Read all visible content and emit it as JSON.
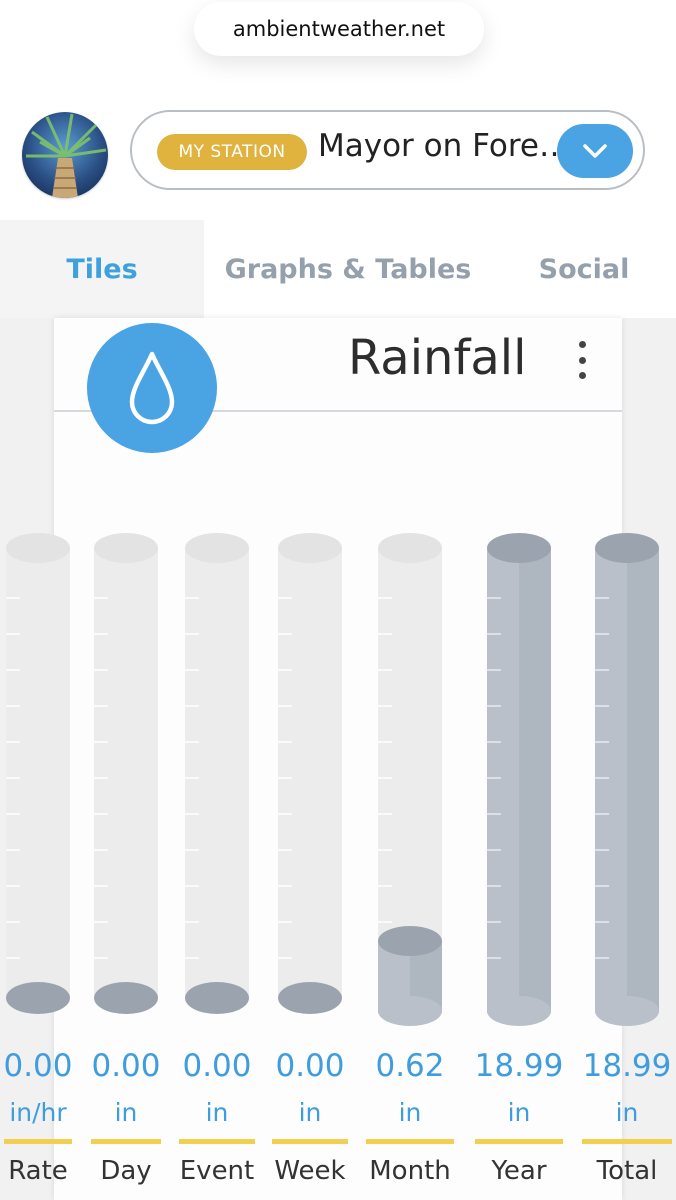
{
  "browser": {
    "url": "ambientweather.net"
  },
  "station": {
    "badge": "MY STATION",
    "name": "Mayor on Fore…"
  },
  "tabs": [
    {
      "label": "Tiles",
      "active": true
    },
    {
      "label": "Graphs & Tables",
      "active": false
    },
    {
      "label": "Social",
      "active": false
    }
  ],
  "tile": {
    "title": "Rainfall",
    "icon": "raindrop-icon",
    "accent": "#4aa3e3"
  },
  "chart_data": {
    "type": "bar",
    "title": "Rainfall",
    "categories": [
      "Rate",
      "Day",
      "Event",
      "Week",
      "Month",
      "Year",
      "Total"
    ],
    "values": [
      0.0,
      0.0,
      0.0,
      0.0,
      0.62,
      18.99,
      18.99
    ],
    "value_labels": [
      "0.00",
      "0.00",
      "0.00",
      "0.00",
      "0.62",
      "18.99",
      "18.99"
    ],
    "units": [
      "in/hr",
      "in",
      "in",
      "in",
      "in",
      "in",
      "in"
    ],
    "fill_fraction": [
      0,
      0,
      0,
      0,
      0.06,
      1,
      1
    ]
  },
  "colors": {
    "value_text": "#3f9dde",
    "underline": "#f2cf4f",
    "tube_empty": "#ececec",
    "tube_fill": "#b9c0c9",
    "tube_bottom": "#9ba4ae"
  }
}
